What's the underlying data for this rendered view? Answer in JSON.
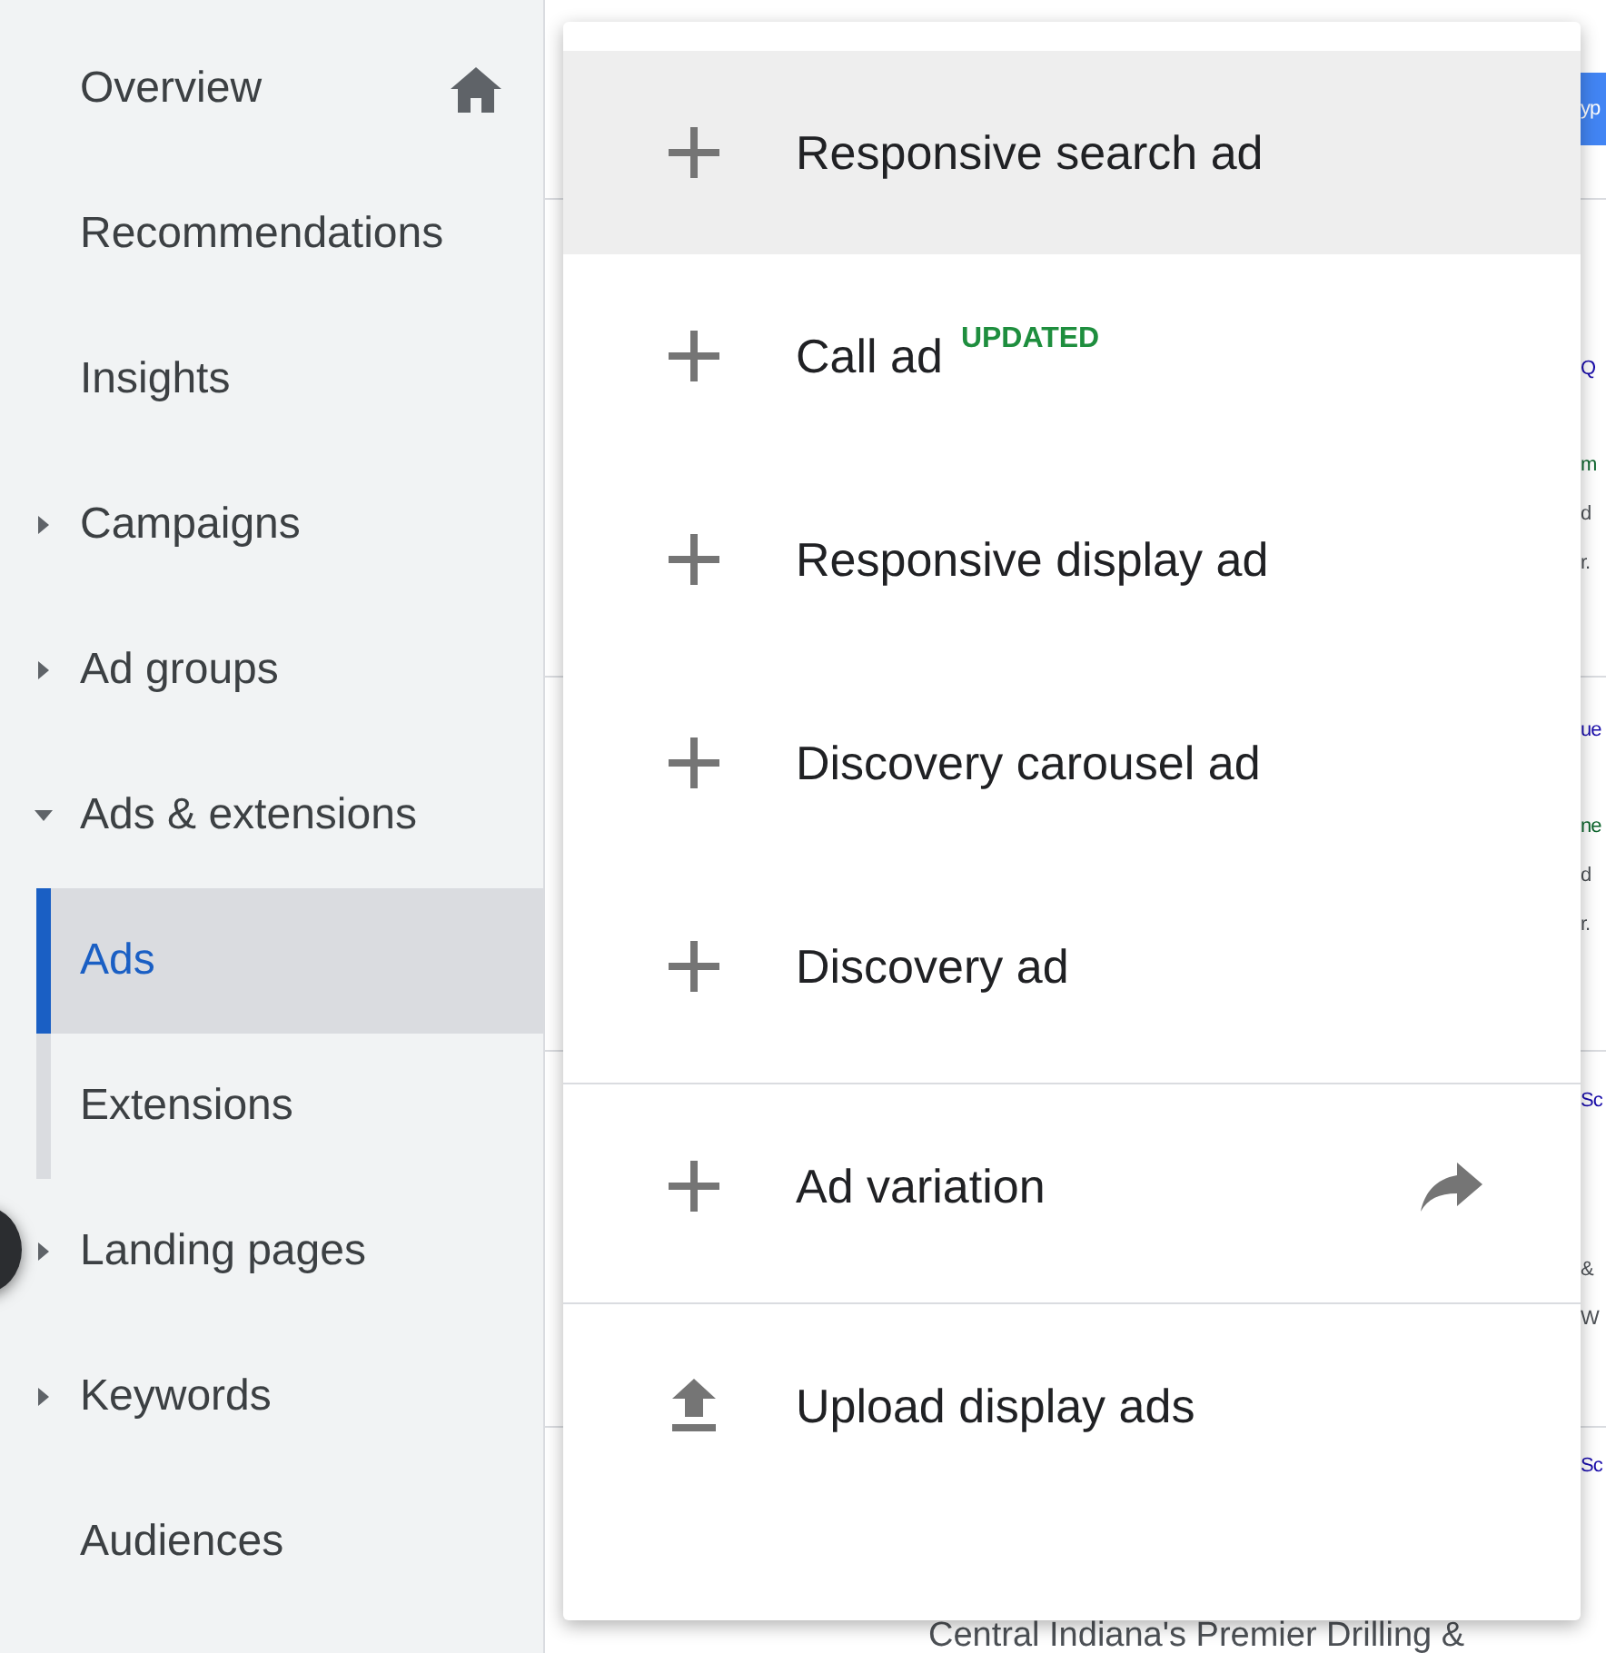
{
  "sidebar": {
    "items": [
      {
        "label": "Overview",
        "kind": "home",
        "selected": false
      },
      {
        "label": "Recommendations",
        "kind": "plain",
        "selected": false
      },
      {
        "label": "Insights",
        "kind": "plain",
        "selected": false
      },
      {
        "label": "Campaigns",
        "kind": "group",
        "expanded": false,
        "selected": false
      },
      {
        "label": "Ad groups",
        "kind": "group",
        "expanded": false,
        "selected": false
      },
      {
        "label": "Ads & extensions",
        "kind": "group",
        "expanded": true,
        "selected": false
      },
      {
        "label": "Ads",
        "kind": "child",
        "selected": true
      },
      {
        "label": "Extensions",
        "kind": "child",
        "selected": false
      },
      {
        "label": "Landing pages",
        "kind": "group",
        "expanded": false,
        "selected": false
      },
      {
        "label": "Keywords",
        "kind": "group",
        "expanded": false,
        "selected": false
      },
      {
        "label": "Audiences",
        "kind": "plain",
        "selected": false
      }
    ]
  },
  "top_button": {
    "label": "yp"
  },
  "ad_rows": [
    {
      "lines": [
        {
          "kind": "title",
          "text": "Q"
        },
        {
          "kind": "url",
          "text": "m"
        },
        {
          "kind": "text",
          "text": "d"
        },
        {
          "kind": "text",
          "text": "r."
        }
      ]
    },
    {
      "lines": [
        {
          "kind": "title",
          "text": "ue"
        },
        {
          "kind": "url",
          "text": "ne"
        },
        {
          "kind": "text",
          "text": "d"
        },
        {
          "kind": "text",
          "text": "r."
        }
      ]
    },
    {
      "lines": [
        {
          "kind": "title",
          "text": "Sc"
        },
        {
          "kind": "gap",
          "text": "&"
        },
        {
          "kind": "text",
          "text": "W"
        }
      ]
    },
    {
      "lines": [
        {
          "kind": "title",
          "text": "Sc"
        }
      ]
    }
  ],
  "footer_text": "Central Indiana's Premier Drilling &",
  "menu": {
    "items": [
      {
        "kind": "add",
        "label": "Responsive search ad",
        "selected": true,
        "divider_before": false
      },
      {
        "kind": "add",
        "label": "Call ad",
        "badge": "UPDATED",
        "selected": false,
        "divider_before": false
      },
      {
        "kind": "add",
        "label": "Responsive display ad",
        "selected": false,
        "divider_before": false
      },
      {
        "kind": "add",
        "label": "Discovery carousel ad",
        "selected": false,
        "divider_before": false
      },
      {
        "kind": "add",
        "label": "Discovery ad",
        "selected": false,
        "divider_before": false
      },
      {
        "kind": "add",
        "label": "Ad variation",
        "trailing_arrow": true,
        "selected": false,
        "divider_before": true
      },
      {
        "kind": "upload",
        "label": "Upload display ads",
        "selected": false,
        "divider_before": true
      }
    ]
  }
}
